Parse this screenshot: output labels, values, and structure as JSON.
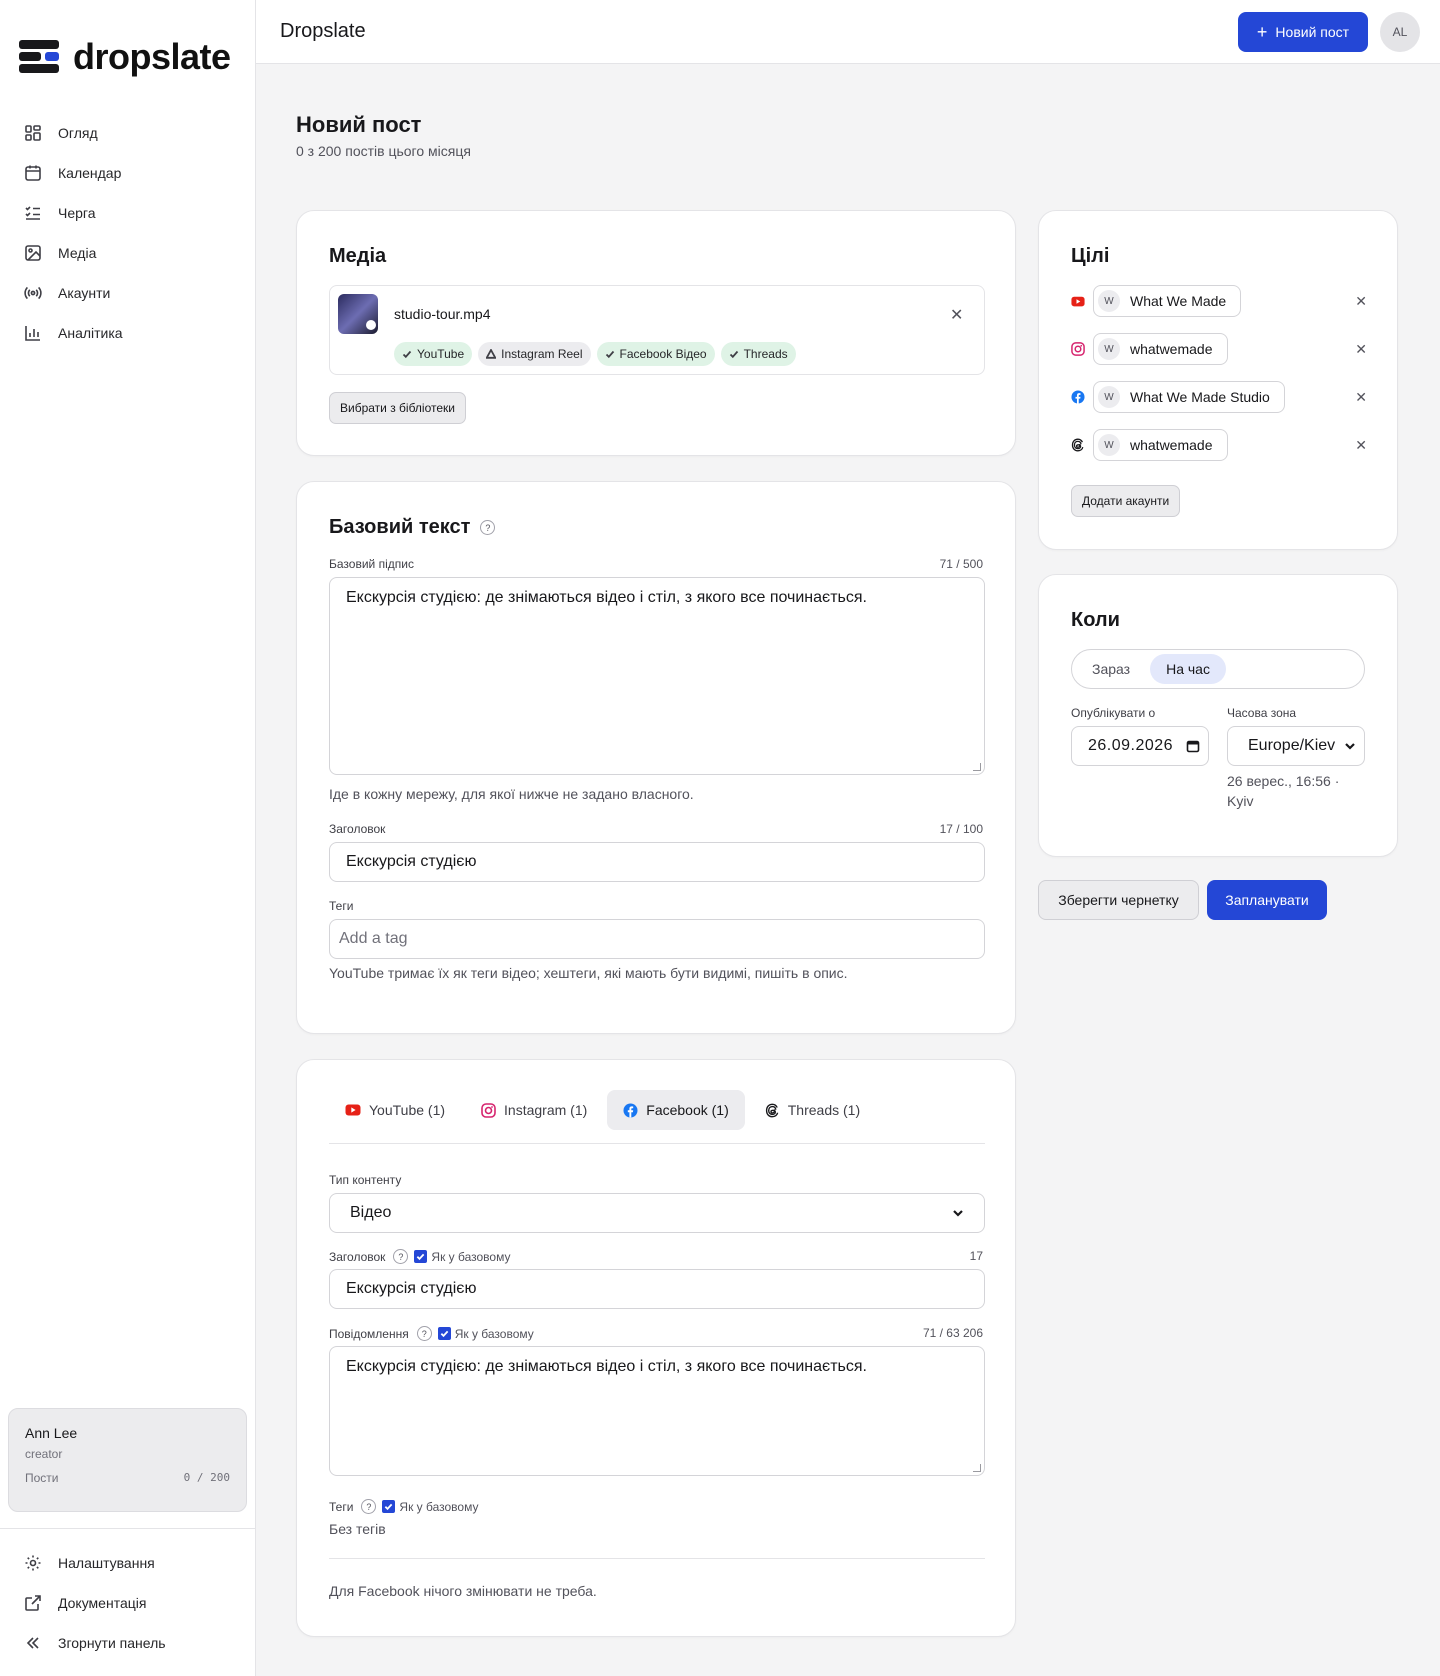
{
  "brand": {
    "name": "dropslate"
  },
  "sidebar": {
    "items": [
      {
        "label": "Огляд",
        "icon": "grid-icon"
      },
      {
        "label": "Календар",
        "icon": "calendar-icon"
      },
      {
        "label": "Черга",
        "icon": "list-check-icon"
      },
      {
        "label": "Медіа",
        "icon": "image-icon"
      },
      {
        "label": "Акаунти",
        "icon": "broadcast-icon"
      },
      {
        "label": "Аналітика",
        "icon": "bar-chart-icon"
      }
    ],
    "user": {
      "name": "Ann Lee",
      "role": "creator",
      "posts_label": "Пости",
      "posts_value": "0 / 200"
    },
    "bottom": [
      {
        "label": "Налаштування",
        "icon": "gear-icon"
      },
      {
        "label": "Документація",
        "icon": "external-link-icon"
      },
      {
        "label": "Згорнути панель",
        "icon": "chevrons-left-icon"
      }
    ]
  },
  "topbar": {
    "title": "Dropslate",
    "new_post_label": "Новий пост",
    "avatar_initials": "AL",
    "accent": "#2447d6"
  },
  "page": {
    "title": "Новий пост",
    "subtitle": "0 з 200 постів цього місяця"
  },
  "media": {
    "title": "Медіа",
    "file_name": "studio-tour.mp4",
    "chips": [
      {
        "label": "YouTube",
        "status": "ok"
      },
      {
        "label": "Instagram Reel",
        "status": "warning"
      },
      {
        "label": "Facebook Відео",
        "status": "ok"
      },
      {
        "label": "Threads",
        "status": "ok"
      }
    ],
    "library_button": "Вибрати з бібліотеки"
  },
  "base_text": {
    "title": "Базовий текст",
    "caption_label": "Базовий підпис",
    "caption_counter": "71 / 500",
    "caption_value": "Екскурсія студією: де знімаються відео і стіл, з якого все починається.",
    "caption_hint": "Іде в кожну мережу, для якої нижче не задано власного.",
    "heading_label": "Заголовок",
    "heading_counter": "17 / 100",
    "heading_value": "Екскурсія студією",
    "tags_label": "Теги",
    "tags_placeholder": "Add a tag",
    "tags_hint": "YouTube тримає їх як теги відео; хештеги, які мають бути видимі, пишіть в опис."
  },
  "platform": {
    "tabs": [
      {
        "label": "YouTube (1)",
        "icon": "youtube-icon",
        "active": false
      },
      {
        "label": "Instagram (1)",
        "icon": "instagram-icon",
        "active": false
      },
      {
        "label": "Facebook (1)",
        "icon": "facebook-icon",
        "active": true
      },
      {
        "label": "Threads (1)",
        "icon": "threads-icon",
        "active": false
      }
    ],
    "content_type_label": "Тип контенту",
    "content_type_value": "Відео",
    "heading_label": "Заголовок",
    "same_as_base": "Як у базовому",
    "heading_counter": "17",
    "heading_value": "Екскурсія студією",
    "message_label": "Повідомлення",
    "message_counter": "71 / 63 206",
    "message_value": "Екскурсія студією: де знімаються відео і стіл, з якого все починається.",
    "tags_label": "Теги",
    "tags_value": "Без тегів",
    "footer_note": "Для Facebook нічого змінювати не треба."
  },
  "targets": {
    "title": "Цілі",
    "items": [
      {
        "network_icon": "youtube-icon",
        "avatar": "W",
        "name": "What We Made"
      },
      {
        "network_icon": "instagram-icon",
        "avatar": "W",
        "name": "whatwemade"
      },
      {
        "network_icon": "facebook-icon",
        "avatar": "W",
        "name": "What We Made Studio"
      },
      {
        "network_icon": "threads-icon",
        "avatar": "W",
        "name": "whatwemade"
      }
    ],
    "add_button": "Додати акаунти"
  },
  "when": {
    "title": "Коли",
    "options": [
      "Зараз",
      "На час"
    ],
    "selected": "На час",
    "publish_label": "Опублікувати о",
    "publish_value": "26.09.2026",
    "timezone_label": "Часова зона",
    "timezone_value": "Europe/Kiev",
    "preview_line1": "26 верес., 16:56 ·",
    "preview_line2": "Kyiv"
  },
  "actions": {
    "save_draft": "Зберегти чернетку",
    "schedule": "Запланувати"
  }
}
